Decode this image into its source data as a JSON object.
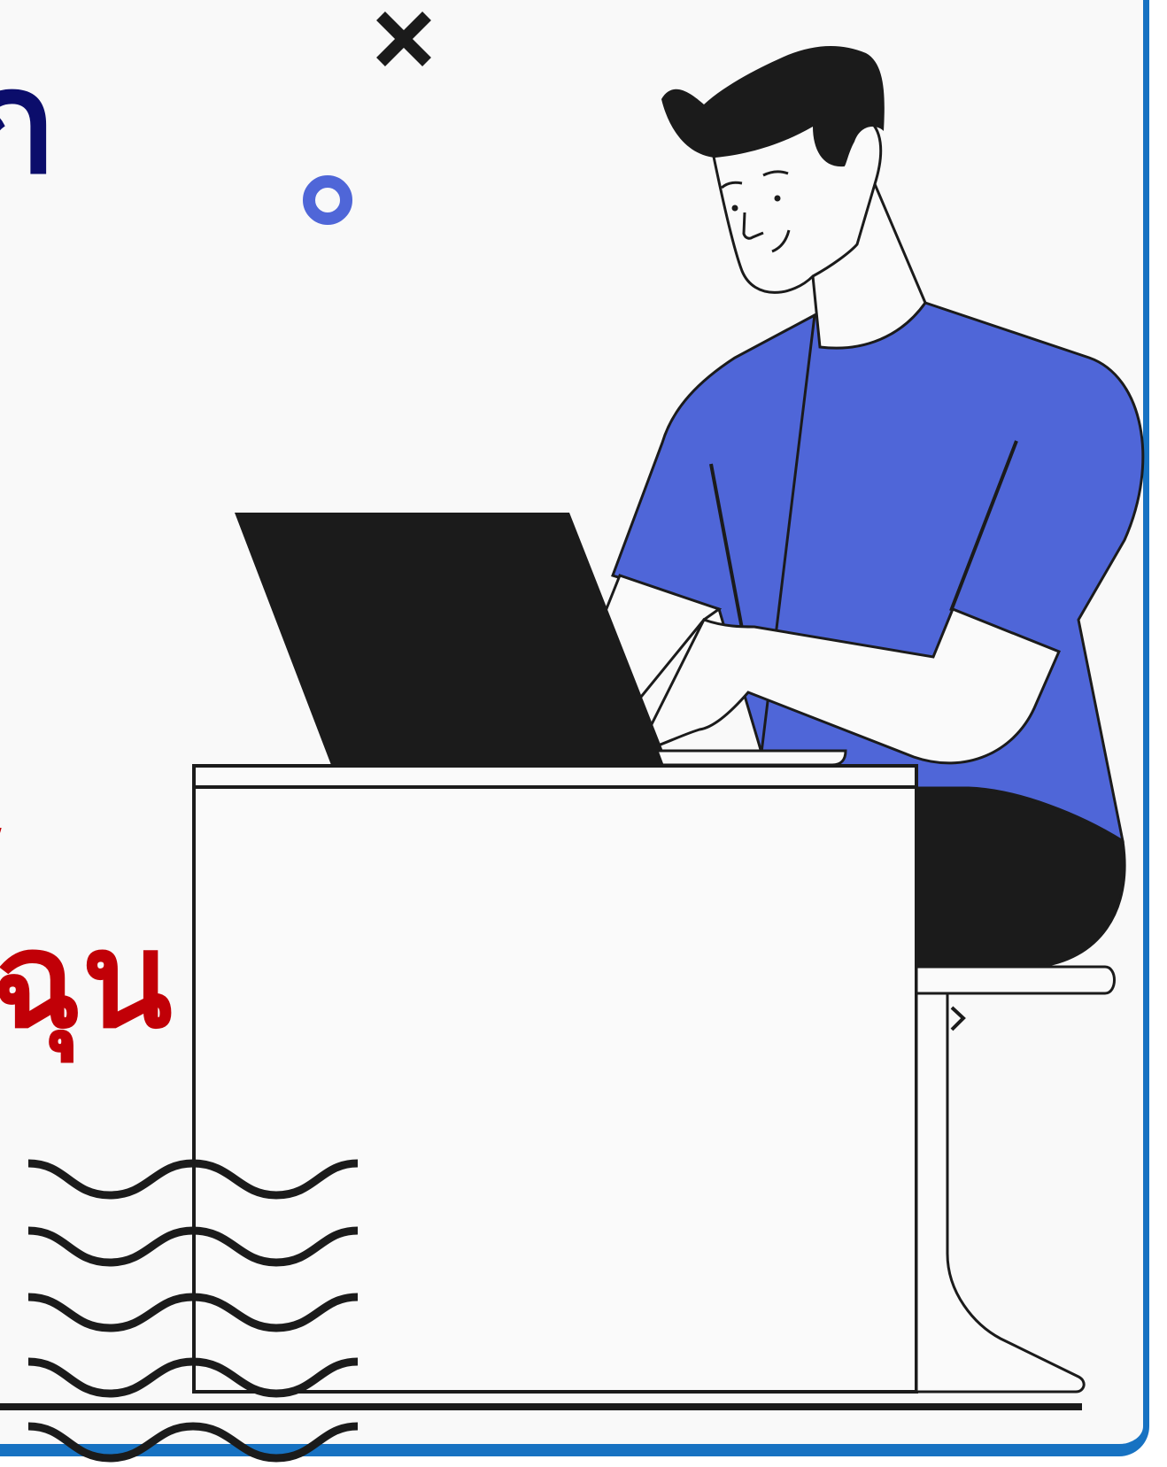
{
  "page": {
    "top_left_title_fragment": "ก",
    "red_text_line_1": "ี้",
    "red_text_line_2": "ฉุน"
  },
  "colors": {
    "accent_blue": "#4f66d8",
    "dark_navy": "#0b0d6b",
    "red": "#c10007",
    "ink": "#1b1b1b",
    "frame_blue": "#1772c2",
    "background": "#f9f9f9"
  },
  "icons": {
    "decor_cross": "x-mark-icon",
    "decor_ring": "ring-icon",
    "decor_waves": "wave-pattern-icon"
  }
}
